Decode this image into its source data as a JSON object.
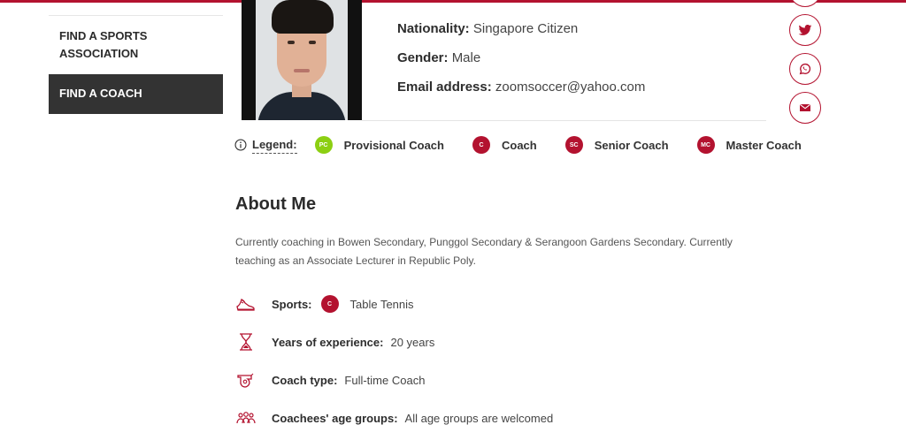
{
  "colors": {
    "accent": "#b3122f",
    "provisional": "#8ccf12",
    "sidebar_active_bg": "#333333"
  },
  "sidebar": {
    "items": [
      {
        "label": "FIND A SPORTS ASSOCIATION"
      },
      {
        "label": "FIND A COACH"
      }
    ]
  },
  "profile": {
    "nationality_label": "Nationality:",
    "nationality": "Singapore Citizen",
    "gender_label": "Gender:",
    "gender": "Male",
    "email_label": "Email address:",
    "email": "zoomsoccer@yahoo.com"
  },
  "social_icons": [
    "share-icon",
    "twitter-icon",
    "whatsapp-icon",
    "email-icon"
  ],
  "legend": {
    "label": "Legend:",
    "items": [
      {
        "abbr": "PC",
        "label": "Provisional Coach"
      },
      {
        "abbr": "C",
        "label": "Coach"
      },
      {
        "abbr": "SC",
        "label": "Senior Coach"
      },
      {
        "abbr": "MC",
        "label": "Master Coach"
      }
    ]
  },
  "about": {
    "title": "About Me",
    "text": "Currently coaching in Bowen Secondary, Punggol Secondary & Serangoon Gardens Secondary. Currently teaching as an Associate Lecturer in Republic Poly."
  },
  "info": {
    "sports_label": "Sports:",
    "sports_badge": "C",
    "sports_value": "Table Tennis",
    "experience_label": "Years of experience:",
    "experience_value": "20 years",
    "coach_type_label": "Coach type:",
    "coach_type_value": "Full-time Coach",
    "age_groups_label": "Coachees' age groups:",
    "age_groups_value": "All age groups are welcomed"
  }
}
